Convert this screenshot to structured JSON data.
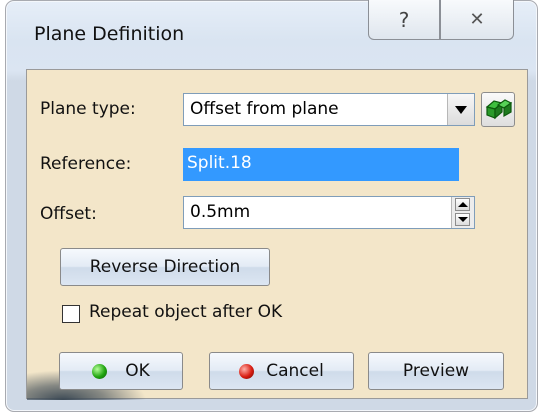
{
  "window": {
    "title": "Plane Definition",
    "help_glyph": "?",
    "close_glyph": "✕"
  },
  "plane_type": {
    "label": "Plane type:",
    "value": "Offset from plane",
    "icon": "plane-geometry-icon"
  },
  "reference": {
    "label": "Reference:",
    "value": "Split.18"
  },
  "offset": {
    "label": "Offset:",
    "value": "0.5mm"
  },
  "reverse_direction_label": "Reverse Direction",
  "repeat_object": {
    "label": "Repeat object after OK",
    "checked": false
  },
  "buttons": {
    "ok": "OK",
    "cancel": "Cancel",
    "preview": "Preview"
  },
  "colors": {
    "selection": "#3399ff",
    "panel": "#f3e6c9",
    "ok_dot": "#21a510",
    "cancel_dot": "#d91d12"
  }
}
